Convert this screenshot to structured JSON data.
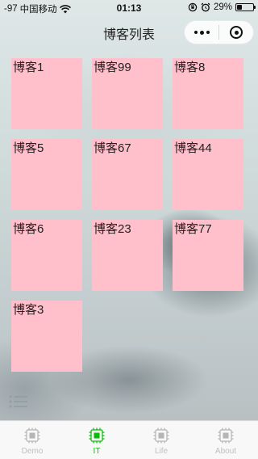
{
  "status_bar": {
    "signal": "-97",
    "carrier": "中国移动",
    "time": "01:13",
    "battery": "29%",
    "battery_level": 0.29
  },
  "nav": {
    "title": "博客列表",
    "more_icon": "more-dots-icon",
    "close_icon": "close-circle-icon"
  },
  "blogs": [
    {
      "label": "博客1"
    },
    {
      "label": "博客99"
    },
    {
      "label": "博客8"
    },
    {
      "label": "博客5"
    },
    {
      "label": "博客67"
    },
    {
      "label": "博客44"
    },
    {
      "label": "博客6"
    },
    {
      "label": "博客23"
    },
    {
      "label": "博客77"
    },
    {
      "label": "博客3"
    }
  ],
  "tabbar": {
    "active_color": "#09bb07",
    "inactive_color": "#c0c0c0",
    "tabs": [
      {
        "label": "Demo",
        "icon": "chip-icon",
        "active": false
      },
      {
        "label": "IT",
        "icon": "chip-icon",
        "active": true
      },
      {
        "label": "Life",
        "icon": "chip-icon",
        "active": false
      },
      {
        "label": "About",
        "icon": "chip-icon",
        "active": false
      }
    ]
  },
  "colors": {
    "card": "#ffc0cb"
  }
}
